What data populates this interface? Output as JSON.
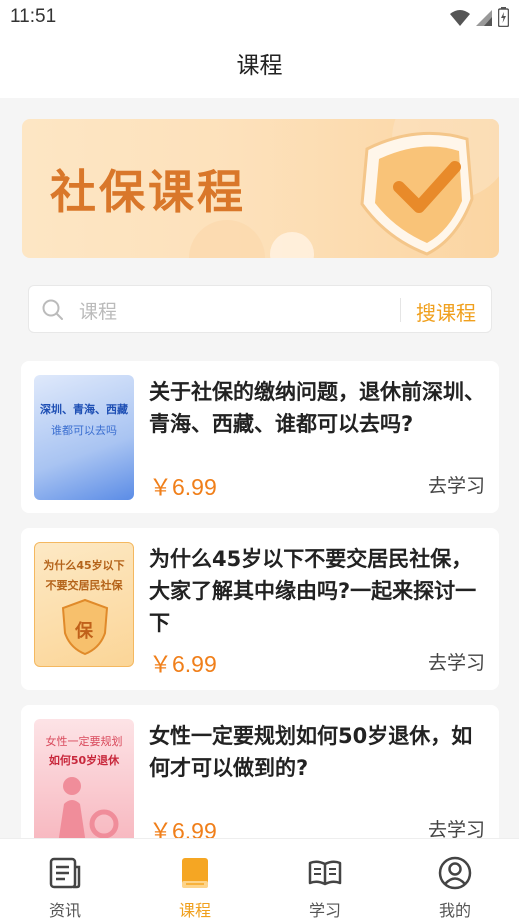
{
  "status_bar": {
    "time": "11:51"
  },
  "header": {
    "title": "课程"
  },
  "banner": {
    "text": "社保课程",
    "icon": "shield-check-icon"
  },
  "search": {
    "placeholder": "课程",
    "button_label": "搜课程",
    "icon": "search-icon"
  },
  "courses": [
    {
      "title": "关于社保的缴纳问题，退休前深圳、青海、西藏、谁都可以去吗?",
      "price": "￥6.99",
      "action": "去学习",
      "thumb_line1": "深圳、青海、西藏",
      "thumb_line2": "谁都可以去吗"
    },
    {
      "title": "为什么45岁以下不要交居民社保，大家了解其中缘由吗?一起来探讨一下",
      "price": "￥6.99",
      "action": "去学习",
      "thumb_line1": "为什么45岁以下",
      "thumb_line2": "不要交居民社保",
      "thumb_badge": "保"
    },
    {
      "title": "女性一定要规划如何50岁退休，如何才可以做到的?",
      "price": "￥6.99",
      "action": "去学习",
      "thumb_line1": "女性一定要规划",
      "thumb_line2": "如何50岁退休"
    }
  ],
  "tabs": [
    {
      "label": "资讯",
      "icon": "news-icon",
      "active": false
    },
    {
      "label": "课程",
      "icon": "book-icon",
      "active": true
    },
    {
      "label": "学习",
      "icon": "open-book-icon",
      "active": false
    },
    {
      "label": "我的",
      "icon": "user-icon",
      "active": false
    }
  ],
  "colors": {
    "accent": "#f0a01e",
    "price": "#f07f1a",
    "background": "#f5f5f5"
  }
}
